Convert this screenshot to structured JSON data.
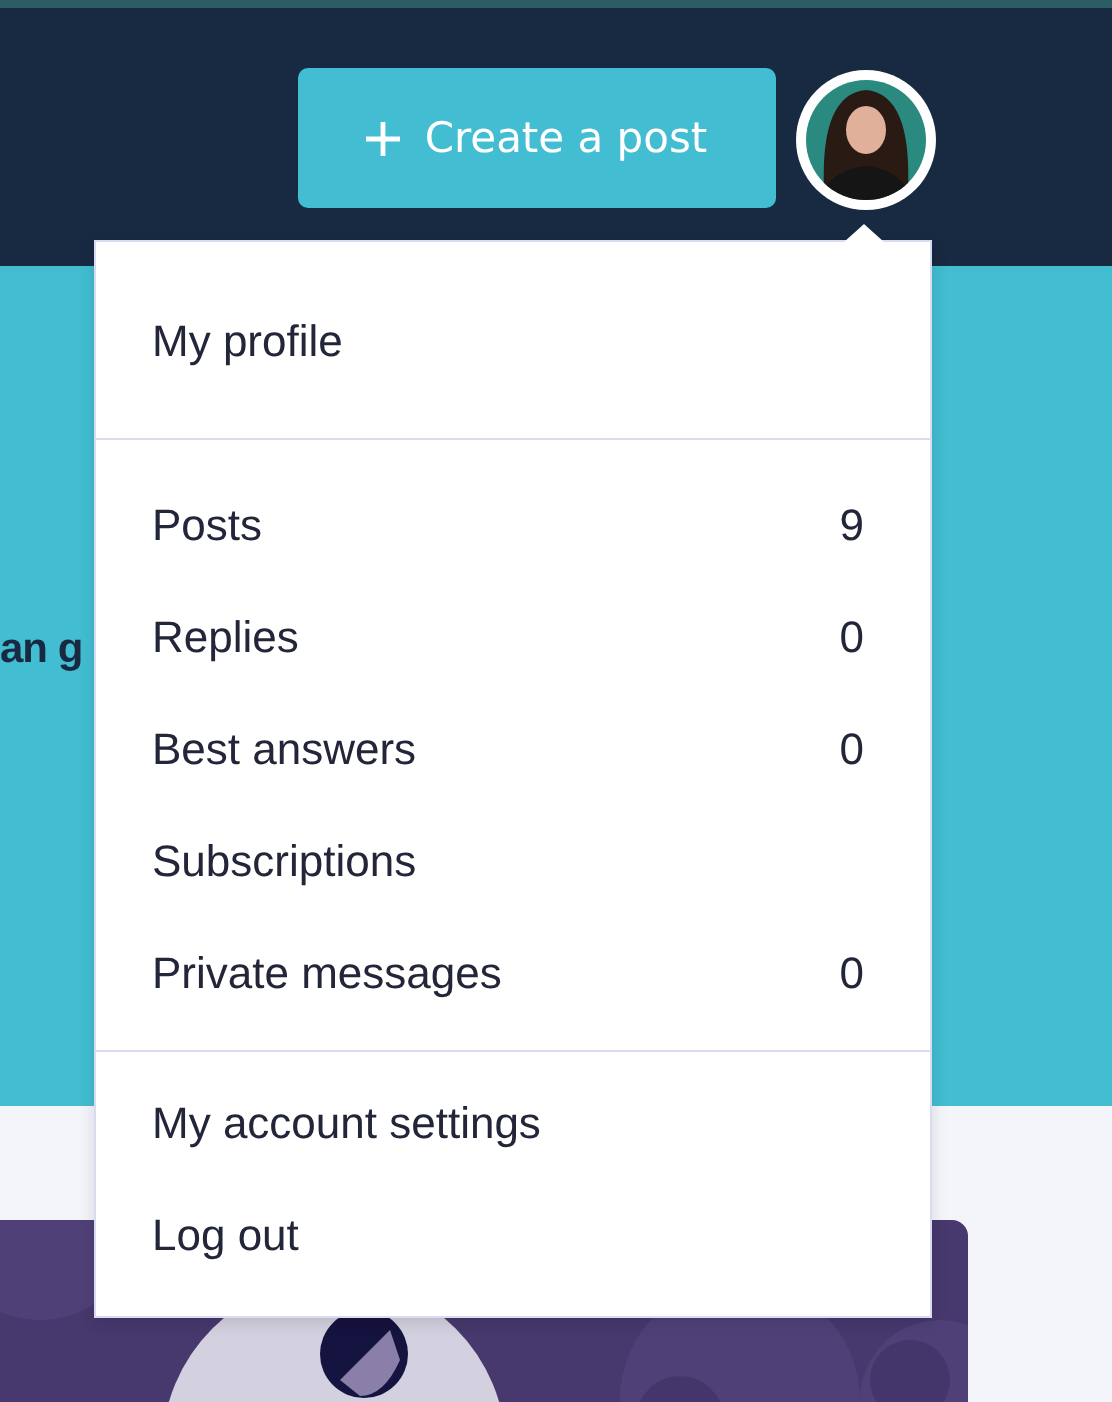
{
  "header": {
    "create_button": {
      "label": "Create a post"
    }
  },
  "banner": {
    "text_fragment": "an g"
  },
  "account_menu": {
    "sections": [
      {
        "items": [
          {
            "label": "My profile"
          }
        ]
      },
      {
        "items": [
          {
            "label": "Posts",
            "count": "9"
          },
          {
            "label": "Replies",
            "count": "0"
          },
          {
            "label": "Best answers",
            "count": "0"
          },
          {
            "label": "Subscriptions"
          },
          {
            "label": "Private messages",
            "count": "0"
          }
        ]
      },
      {
        "items": [
          {
            "label": "My account settings"
          },
          {
            "label": "Log out"
          }
        ]
      }
    ]
  }
}
